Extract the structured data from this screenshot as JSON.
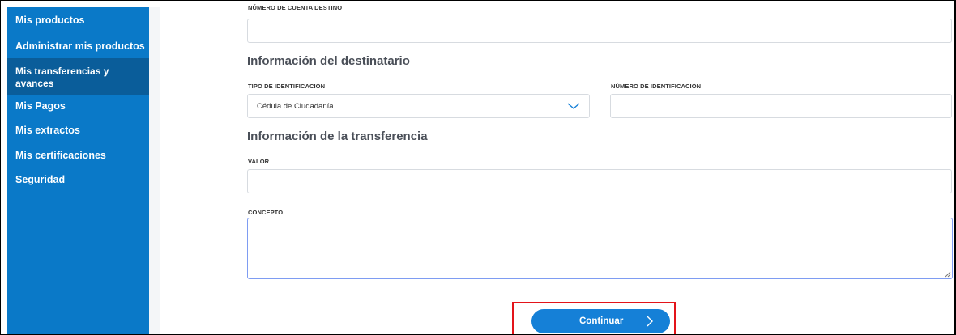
{
  "sidebar": {
    "items": [
      {
        "label": "Mis productos"
      },
      {
        "label": "Administrar mis productos"
      },
      {
        "label": "Mis transferencias y",
        "label2": "avances",
        "active": true
      },
      {
        "label": "Mis Pagos"
      },
      {
        "label": "Mis extractos"
      },
      {
        "label": "Mis certificaciones"
      },
      {
        "label": "Seguridad"
      }
    ]
  },
  "form": {
    "account_dest_label": "NÚMERO DE CUENTA DESTINO",
    "account_dest_value": "",
    "recipient_section": "Información del destinatario",
    "id_type_label": "TIPO DE IDENTIFICACIÓN",
    "id_type_value": "Cédula de Ciudadanía",
    "id_number_label": "NÚMERO DE IDENTIFICACIÓN",
    "id_number_value": "",
    "transfer_section": "Información de la transferencia",
    "amount_label": "VALOR",
    "amount_value": "",
    "concept_label": "CONCEPTO",
    "concept_value": ""
  },
  "actions": {
    "continue_label": "Continuar"
  },
  "colors": {
    "sidebar": "#0a79c8",
    "sidebar_active": "#0a5d9a",
    "primary_button": "#1580d7",
    "highlight_box": "#e3141a"
  },
  "icons": {
    "select_chevron": "chevron-down-icon",
    "button_arrow": "chevron-right-icon",
    "textarea_resize": "resize-handle-icon"
  }
}
